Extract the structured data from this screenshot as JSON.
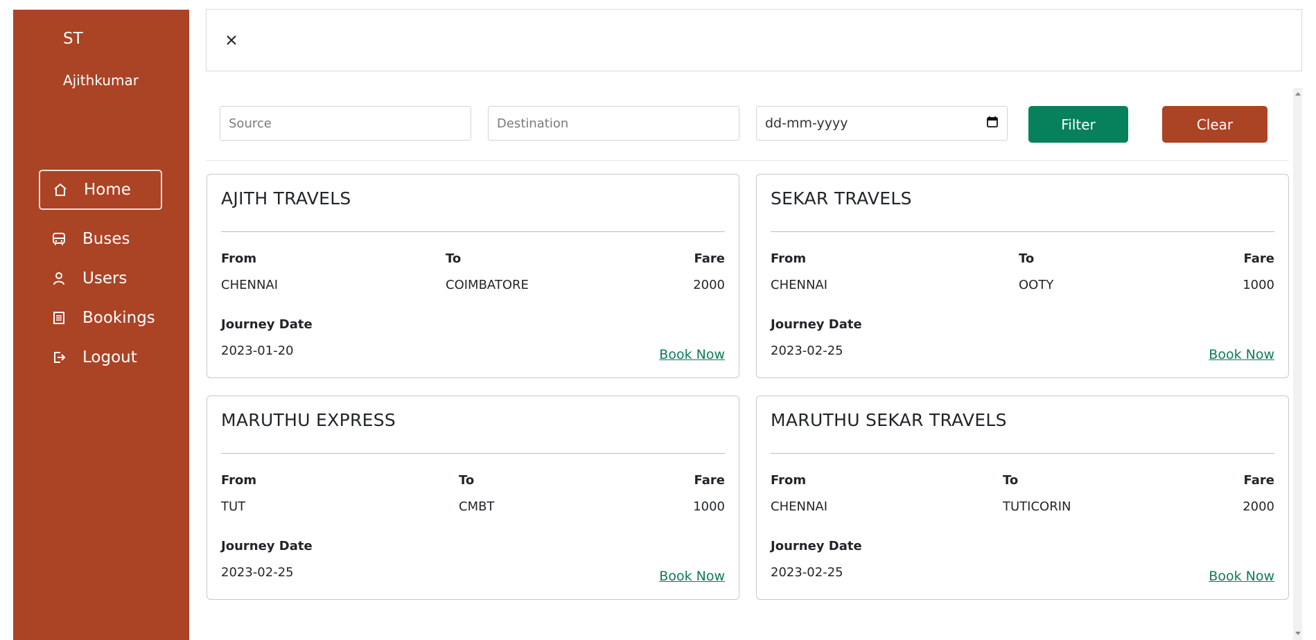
{
  "sidebar": {
    "brand": "ST",
    "username": "Ajithkumar",
    "items": [
      {
        "label": "Home",
        "icon": "home-icon",
        "active": true
      },
      {
        "label": "Buses",
        "icon": "bus-icon"
      },
      {
        "label": "Users",
        "icon": "user-icon"
      },
      {
        "label": "Bookings",
        "icon": "list-icon"
      },
      {
        "label": "Logout",
        "icon": "logout-icon"
      }
    ]
  },
  "topbar": {
    "close_icon": "close-icon"
  },
  "filters": {
    "source_placeholder": "Source",
    "destination_placeholder": "Destination",
    "date_placeholder": "dd-mm-yyyy",
    "filter_label": "Filter",
    "clear_label": "Clear"
  },
  "labels": {
    "from": "From",
    "to": "To",
    "fare": "Fare",
    "journey_date": "Journey Date",
    "book_now": "Book Now"
  },
  "buses": [
    {
      "name": "AJITH TRAVELS",
      "from": "CHENNAI",
      "to": "COIMBATORE",
      "fare": "2000",
      "date": "2023-01-20"
    },
    {
      "name": "SEKAR TRAVELS",
      "from": "CHENNAI",
      "to": "OOTY",
      "fare": "1000",
      "date": "2023-02-25"
    },
    {
      "name": "MARUTHU EXPRESS",
      "from": "TUT",
      "to": "CMBT",
      "fare": "1000",
      "date": "2023-02-25"
    },
    {
      "name": "MARUTHU SEKAR TRAVELS",
      "from": "CHENNAI",
      "to": "TUTICORIN",
      "fare": "2000",
      "date": "2023-02-25"
    }
  ],
  "colors": {
    "sidebar": "#ab4325",
    "filter_button": "#06815b",
    "clear_button": "#ab4325",
    "link": "#0d7a57"
  }
}
